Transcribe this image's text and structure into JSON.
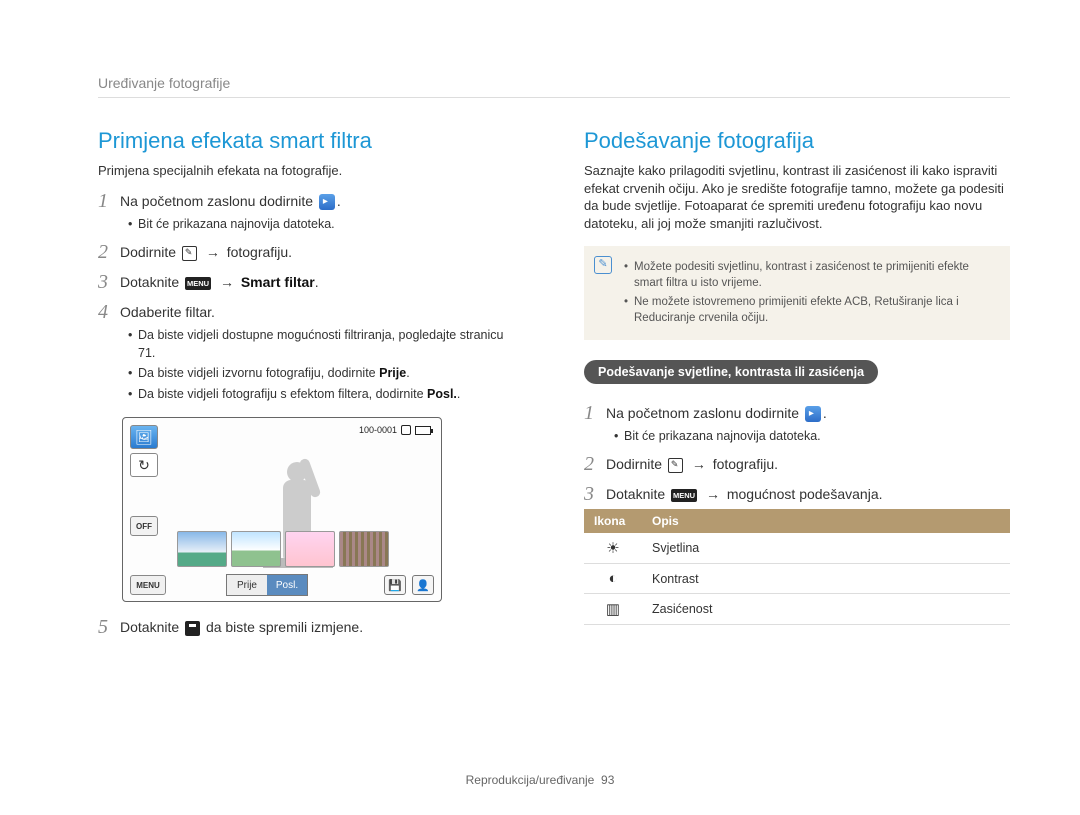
{
  "page_header": "Uređivanje fotografije",
  "footer_label": "Reprodukcija/uređivanje",
  "footer_page": "93",
  "left": {
    "title": "Primjena efekata smart filtra",
    "intro": "Primjena specijalnih efekata na fotografije.",
    "step1": "Na početnom zaslonu dodirnite",
    "step1_tail": ".",
    "step1_bullet": "Bit će prikazana najnovija datoteka.",
    "step2_a": "Dodirnite",
    "step2_b": "fotografiju.",
    "step3_a": "Dotaknite",
    "step3_b": "Smart filtar",
    "step3_tail": ".",
    "step4": "Odaberite filtar.",
    "step4_b1": "Da biste vidjeli dostupne mogućnosti filtriranja, pogledajte stranicu 71.",
    "step4_b2_a": "Da biste vidjeli izvornu fotografiju, dodirnite ",
    "step4_b2_b": "Prije",
    "step4_b2_c": ".",
    "step4_b3_a": "Da biste vidjeli fotografiju s efektom filtera, dodirnite ",
    "step4_b3_b": "Posl.",
    "step4_b3_c": ".",
    "step5_a": "Dotaknite",
    "step5_b": "da biste spremili izmjene.",
    "cam": {
      "status_text": "100-0001",
      "off_label": "OFF",
      "menu_label": "MENU",
      "tab_before": "Prije",
      "tab_after": "Posl."
    }
  },
  "right": {
    "title": "Podešavanje fotografija",
    "intro": "Saznajte kako prilagoditi svjetlinu, kontrast ili zasićenost ili kako ispraviti efekat crvenih očiju. Ako je središte fotografije tamno, možete ga podesiti da bude svjetlije. Fotoaparat će spremiti uređenu fotografiju kao novu datoteku, ali joj može smanjiti razlučivost.",
    "note1": "Možete podesiti svjetlinu, kontrast i zasićenost te primijeniti efekte smart filtra u isto vrijeme.",
    "note2": "Ne možete istovremeno primijeniti efekte ACB, Retuširanje lica i Reduciranje crvenila očiju.",
    "sub_heading": "Podešavanje svjetline, kontrasta ili zasićenja",
    "step1": "Na početnom zaslonu dodirnite",
    "step1_tail": ".",
    "step1_bullet": "Bit će prikazana najnovija datoteka.",
    "step2_a": "Dodirnite",
    "step2_b": "fotografiju.",
    "step3_a": "Dotaknite",
    "step3_b": "mogućnost podešavanja.",
    "table": {
      "h_icon": "Ikona",
      "h_desc": "Opis",
      "r1": "Svjetlina",
      "r2": "Kontrast",
      "r3": "Zasićenost"
    }
  }
}
